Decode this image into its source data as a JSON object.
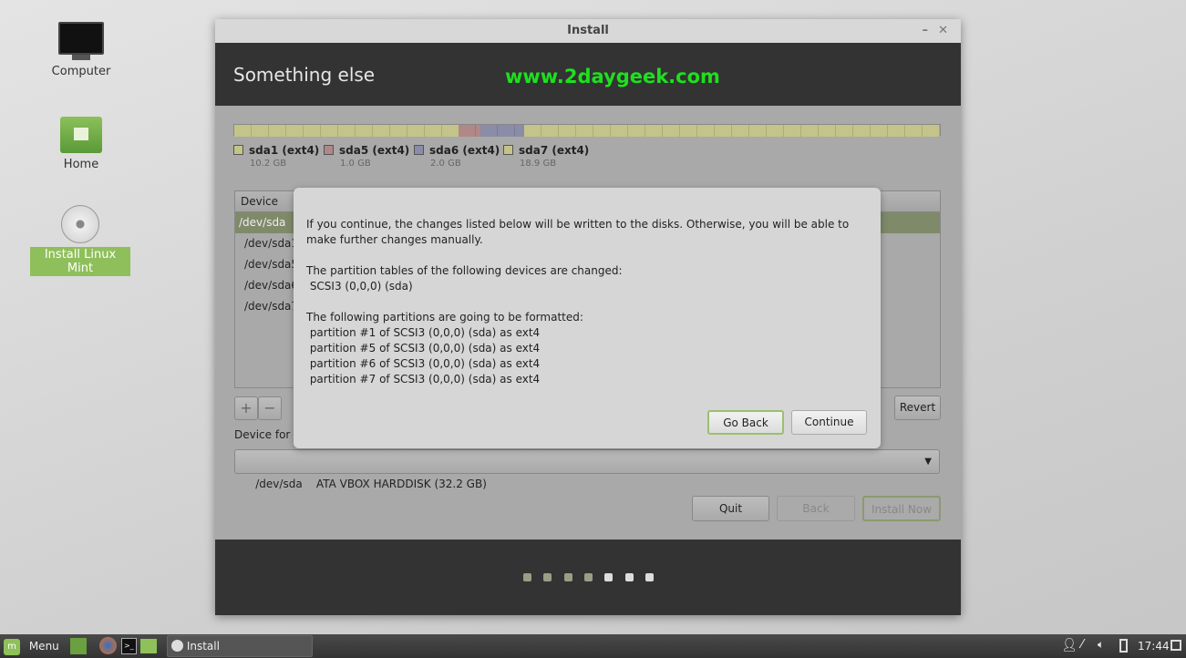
{
  "desktop": {
    "icons": [
      {
        "label": "Computer"
      },
      {
        "label": "Home"
      },
      {
        "label": "Install Linux Mint"
      }
    ]
  },
  "window": {
    "title": "Install",
    "header_title": "Something else",
    "watermark": "www.2daygeek.com"
  },
  "partition_bar": {
    "segments": [
      {
        "name": "sda1 (ext4)",
        "size": "10.2 GB",
        "color": "#c4c48a",
        "gb": 10.2
      },
      {
        "name": "sda5 (ext4)",
        "size": "1.0 GB",
        "color": "#b08888",
        "gb": 1.0
      },
      {
        "name": "sda6 (ext4)",
        "size": "2.0 GB",
        "color": "#8a8ca8",
        "gb": 2.0
      },
      {
        "name": "sda7 (ext4)",
        "size": "18.9 GB",
        "color": "#c4c48a",
        "gb": 18.9
      }
    ]
  },
  "table": {
    "header": "Device",
    "rows": [
      "/dev/sda",
      "/dev/sda1",
      "/dev/sda5",
      "/dev/sda6",
      "/dev/sda7"
    ]
  },
  "toolbar": {
    "add": "+",
    "remove": "−",
    "revert": "Revert"
  },
  "boot": {
    "label": "Device for b",
    "selected": "/dev/sda    ATA VBOX HARDDISK (32.2 GB)"
  },
  "buttons": {
    "quit": "Quit",
    "back": "Back",
    "install_now": "Install Now"
  },
  "progress": {
    "total_steps": 7,
    "current_step": 4
  },
  "dialog": {
    "intro": "If you continue, the changes listed below will be written to the disks. Otherwise, you will be able to make further changes manually.",
    "tables_heading": "The partition tables of the following devices are changed:",
    "tables": [
      " SCSI3 (0,0,0) (sda)"
    ],
    "format_heading": "The following partitions are going to be formatted:",
    "formats": [
      " partition #1 of SCSI3 (0,0,0) (sda) as ext4",
      " partition #5 of SCSI3 (0,0,0) (sda) as ext4",
      " partition #6 of SCSI3 (0,0,0) (sda) as ext4",
      " partition #7 of SCSI3 (0,0,0) (sda) as ext4"
    ],
    "go_back": "Go Back",
    "continue": "Continue"
  },
  "taskbar": {
    "menu": "Menu",
    "task": "Install",
    "clock": "17:44"
  }
}
